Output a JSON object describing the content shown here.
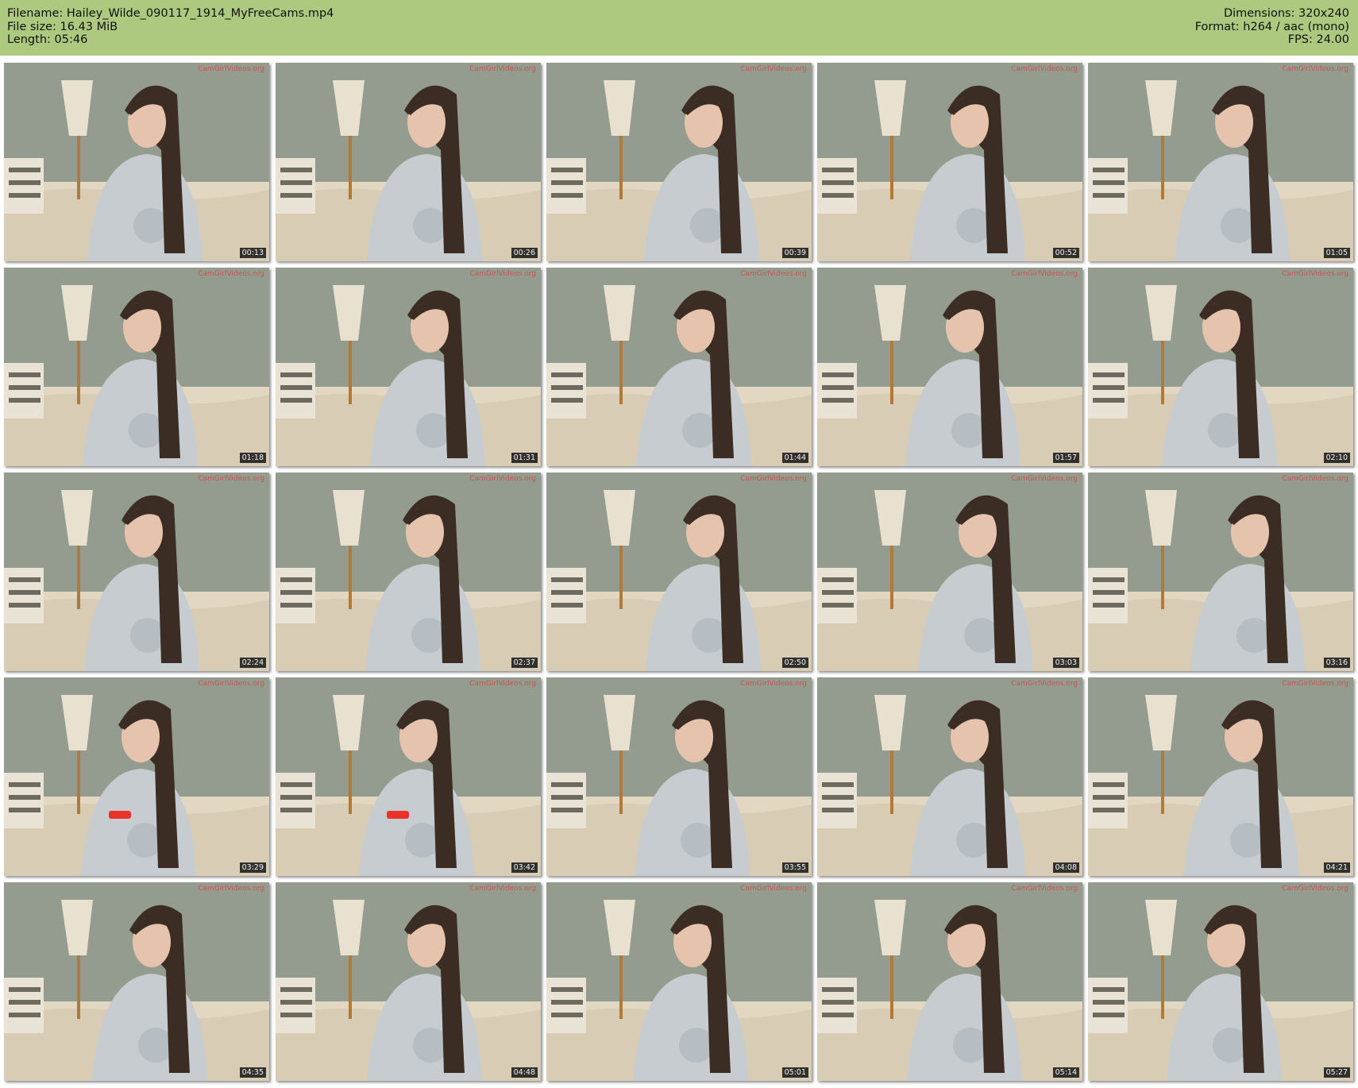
{
  "header": {
    "filename": "Filename: Hailey_Wilde_090117_1914_MyFreeCams.mp4",
    "file_size": "File size: 16.43 MiB",
    "length": "Length: 05:46",
    "dimensions": "Dimensions: 320x240",
    "format": "Format: h264 / aac (mono)",
    "fps": "FPS: 24.00"
  },
  "colors": {
    "header_bg": "#acc97f",
    "wall": "#939c8e",
    "bed": "#e2d8c2",
    "hoodie": "#c7ccd0",
    "hair": "#3b2d24",
    "phone": "#e8322a"
  },
  "watermark": "CamGirlVideos.org",
  "thumbnails": [
    {
      "time": "00:13"
    },
    {
      "time": "00:26"
    },
    {
      "time": "00:39"
    },
    {
      "time": "00:52"
    },
    {
      "time": "01:05"
    },
    {
      "time": "01:18"
    },
    {
      "time": "01:31"
    },
    {
      "time": "01:44"
    },
    {
      "time": "01:57"
    },
    {
      "time": "02:10"
    },
    {
      "time": "02:24"
    },
    {
      "time": "02:37"
    },
    {
      "time": "02:50"
    },
    {
      "time": "03:03"
    },
    {
      "time": "03:16"
    },
    {
      "time": "03:29",
      "phone": true
    },
    {
      "time": "03:42",
      "phone": true
    },
    {
      "time": "03:55"
    },
    {
      "time": "04:08"
    },
    {
      "time": "04:21"
    },
    {
      "time": "04:35"
    },
    {
      "time": "04:48"
    },
    {
      "time": "05:01"
    },
    {
      "time": "05:14"
    },
    {
      "time": "05:27"
    }
  ]
}
